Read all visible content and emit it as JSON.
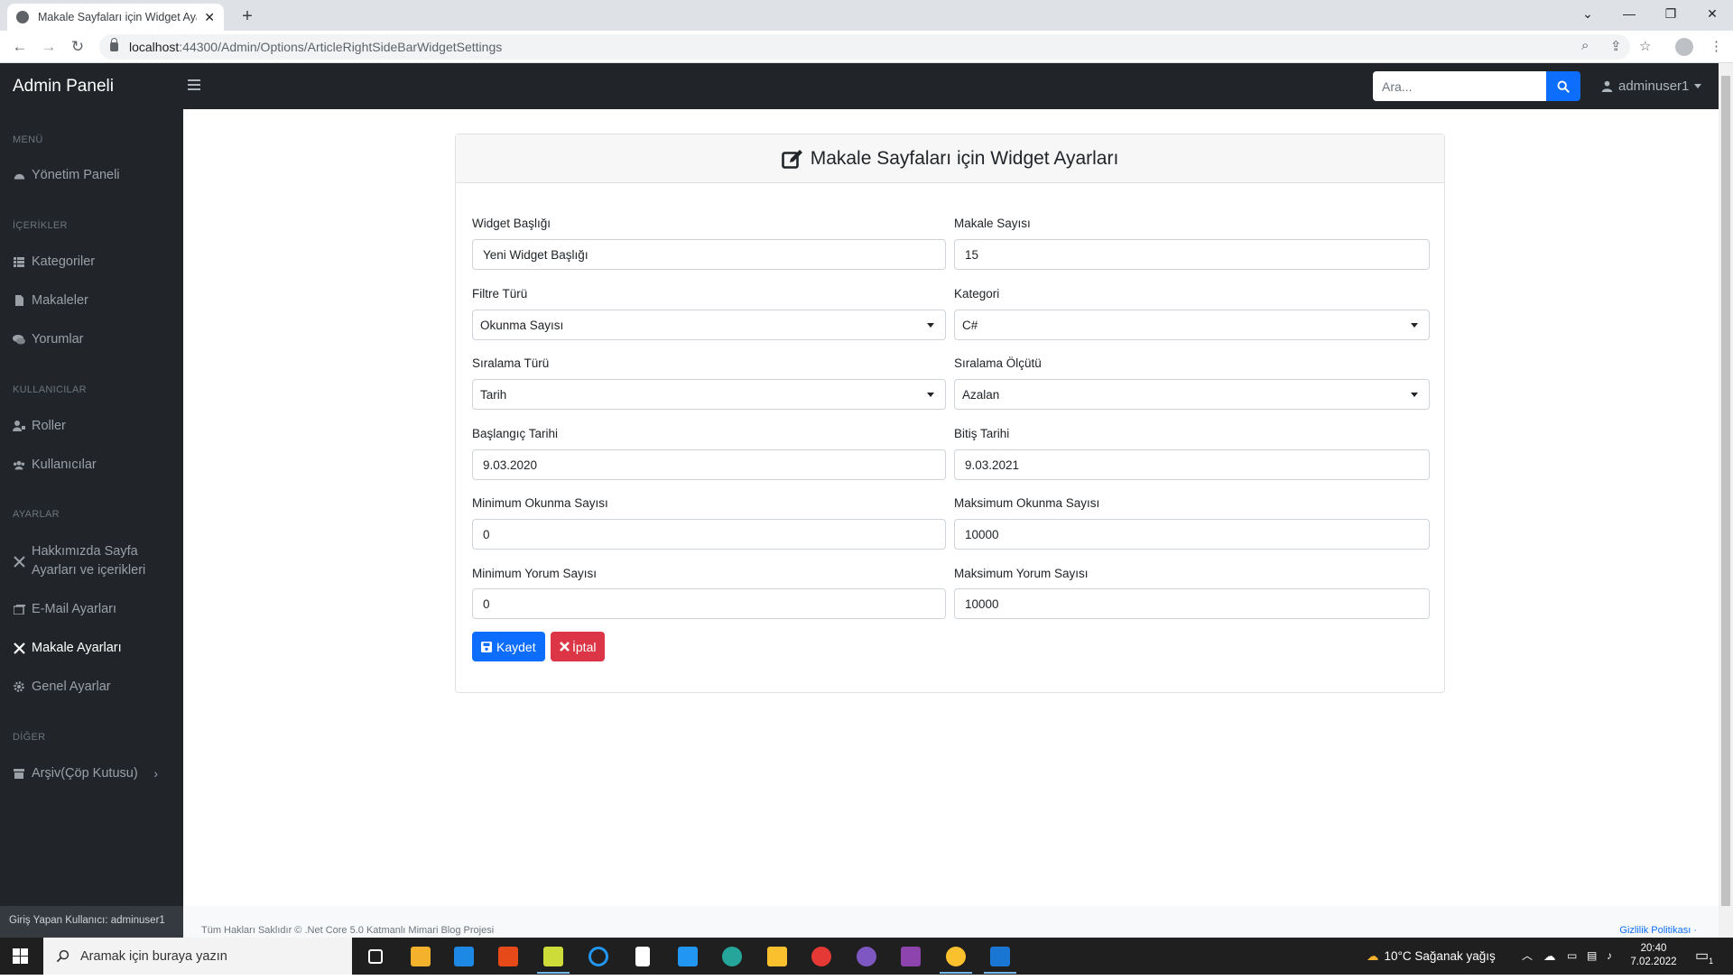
{
  "browser": {
    "tab_title": "Makale Sayfaları için Widget Ayar",
    "url_host": "localhost",
    "url_path": ":44300/Admin/Options/ArticleRightSideBarWidgetSettings"
  },
  "topbar": {
    "brand": "Admin Paneli",
    "search_placeholder": "Ara...",
    "username": "adminuser1"
  },
  "sidebar": {
    "sections": {
      "menu": "MENÜ",
      "contents": "İÇERİKLER",
      "users": "KULLANICILAR",
      "settings": "AYARLAR",
      "other": "DİĞER"
    },
    "items": {
      "dashboard": "Yönetim Paneli",
      "categories": "Kategoriler",
      "articles": "Makaleler",
      "comments": "Yorumlar",
      "roles": "Roller",
      "users": "Kullanıcılar",
      "about_line1": "Hakkımızda Sayfa",
      "about_line2": "Ayarları ve içerikleri",
      "email": "E-Mail Ayarları",
      "article_settings": "Makale Ayarları",
      "general": "Genel Ayarlar",
      "archive": "Arşiv(Çöp Kutusu)"
    },
    "footer": "Giriş Yapan Kullanıcı: adminuser1"
  },
  "form": {
    "title": "Makale Sayfaları için Widget Ayarları",
    "widget_title_label": "Widget Başlığı",
    "widget_title_value": "Yeni Widget Başlığı",
    "article_count_label": "Makale Sayısı",
    "article_count_value": "15",
    "filter_type_label": "Filtre Türü",
    "filter_type_value": "Okunma Sayısı",
    "category_label": "Kategori",
    "category_value": "C#",
    "order_type_label": "Sıralama Türü",
    "order_type_value": "Tarih",
    "order_criteria_label": "Sıralama Ölçütü",
    "order_criteria_value": "Azalan",
    "start_date_label": "Başlangıç Tarihi",
    "start_date_value": "9.03.2020",
    "end_date_label": "Bitiş Tarihi",
    "end_date_value": "9.03.2021",
    "min_view_label": "Minimum Okunma Sayısı",
    "min_view_value": "0",
    "max_view_label": "Maksimum Okunma Sayısı",
    "max_view_value": "10000",
    "min_comment_label": "Minimum Yorum Sayısı",
    "min_comment_value": "0",
    "max_comment_label": "Maksimum Yorum Sayısı",
    "max_comment_value": "10000",
    "save_label": "Kaydet",
    "cancel_label": "İptal"
  },
  "footer": {
    "copyright": "Tüm Hakları Saklıdır © .Net Core 5.0 Katmanlı Mimari Blog Projesi",
    "privacy": "Gizlilik Politikası ·"
  },
  "taskbar": {
    "search_placeholder": "Aramak için buraya yazın",
    "weather": "10°C  Sağanak yağış",
    "time": "20:40",
    "date": "7.02.2022",
    "notification_count": "1"
  },
  "colors": {
    "primary": "#0d6efd",
    "danger": "#dc3545",
    "dark": "#212529"
  }
}
